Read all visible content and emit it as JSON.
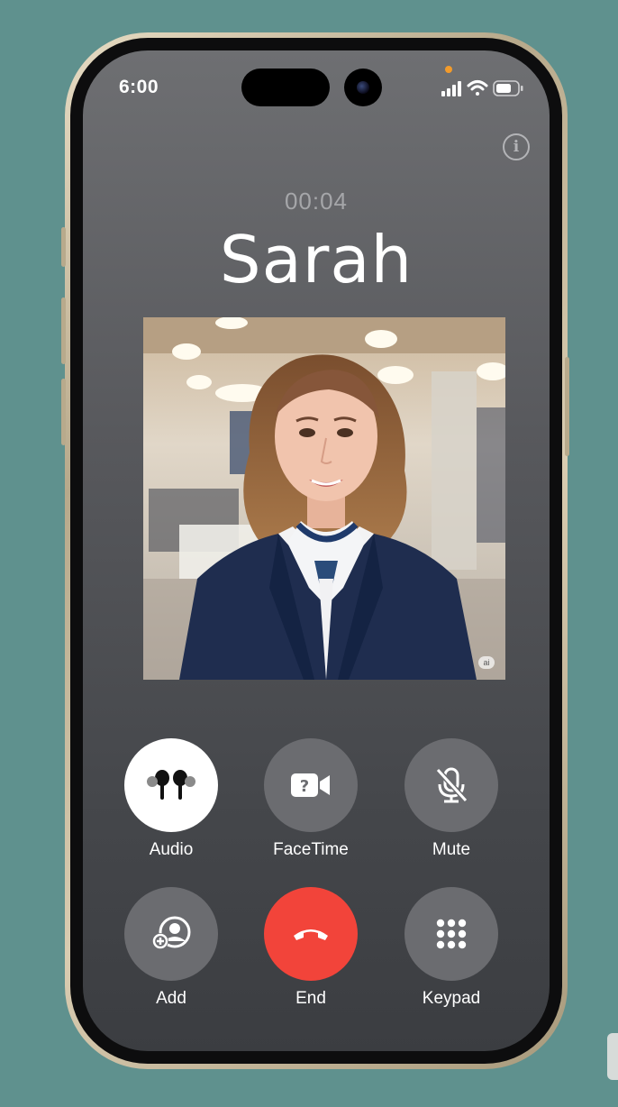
{
  "status_bar": {
    "time": "6:00"
  },
  "call": {
    "timer": "00:04",
    "contact_name": "Sarah",
    "photo_badge": "ai"
  },
  "controls": [
    {
      "label": "Audio",
      "icon": "airpods-icon",
      "state": "active"
    },
    {
      "label": "FaceTime",
      "icon": "facetime-icon",
      "state": "normal"
    },
    {
      "label": "Mute",
      "icon": "mute-mic-icon",
      "state": "normal"
    },
    {
      "label": "Add",
      "icon": "add-person-icon",
      "state": "normal"
    },
    {
      "label": "End",
      "icon": "end-call-icon",
      "state": "end"
    },
    {
      "label": "Keypad",
      "icon": "keypad-icon",
      "state": "normal"
    }
  ],
  "colors": {
    "background": "#5f918e",
    "end_call": "#f2443a",
    "button": "#6b6c70",
    "active_button": "#ffffff"
  }
}
